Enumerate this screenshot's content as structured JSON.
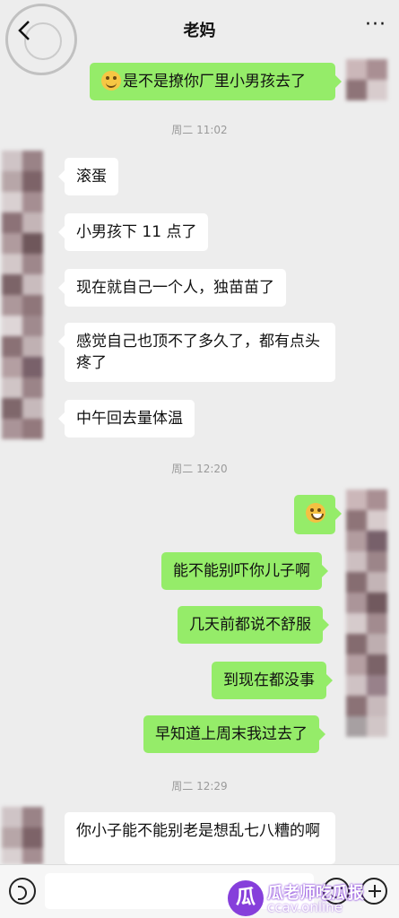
{
  "header": {
    "title": "老妈",
    "back_icon": "chevron-left-icon",
    "more_icon": "more-dots-icon",
    "more_label": "···"
  },
  "timestamps": [
    "周二 11:02",
    "周二 12:20",
    "周二 12:29"
  ],
  "messages": [
    {
      "side": "out",
      "emoji": "grin-emoji",
      "text": "是不是撩你厂里小男孩去了"
    },
    {
      "side": "in",
      "text": "滚蛋"
    },
    {
      "side": "in",
      "text": "小男孩下 11 点了"
    },
    {
      "side": "in",
      "text": "现在就自己一个人，独苗苗了"
    },
    {
      "side": "in",
      "text": "感觉自己也顶不了多久了，都有点头疼了"
    },
    {
      "side": "in",
      "text": "中午回去量体温"
    },
    {
      "side": "out",
      "emoji": "laugh-cry-emoji",
      "text": ""
    },
    {
      "side": "out",
      "text": "能不能别吓你儿子啊"
    },
    {
      "side": "out",
      "text": "几天前都说不舒服"
    },
    {
      "side": "out",
      "text": "到现在都没事"
    },
    {
      "side": "out",
      "text": "早知道上周末我过去了"
    },
    {
      "side": "in",
      "text": "你小子能不能别老是想乱七八糟的啊"
    }
  ],
  "input_bar": {
    "voice_icon": "voice-icon",
    "emoji_icon": "emoji-icon",
    "plus_icon": "plus-icon"
  },
  "watermark": {
    "logo_char": "瓜",
    "title": "瓜老师吃瓜报",
    "domain": "ccav.online"
  },
  "colors": {
    "background": "#ededed",
    "outgoing_bubble": "#95ec69",
    "incoming_bubble": "#ffffff"
  }
}
